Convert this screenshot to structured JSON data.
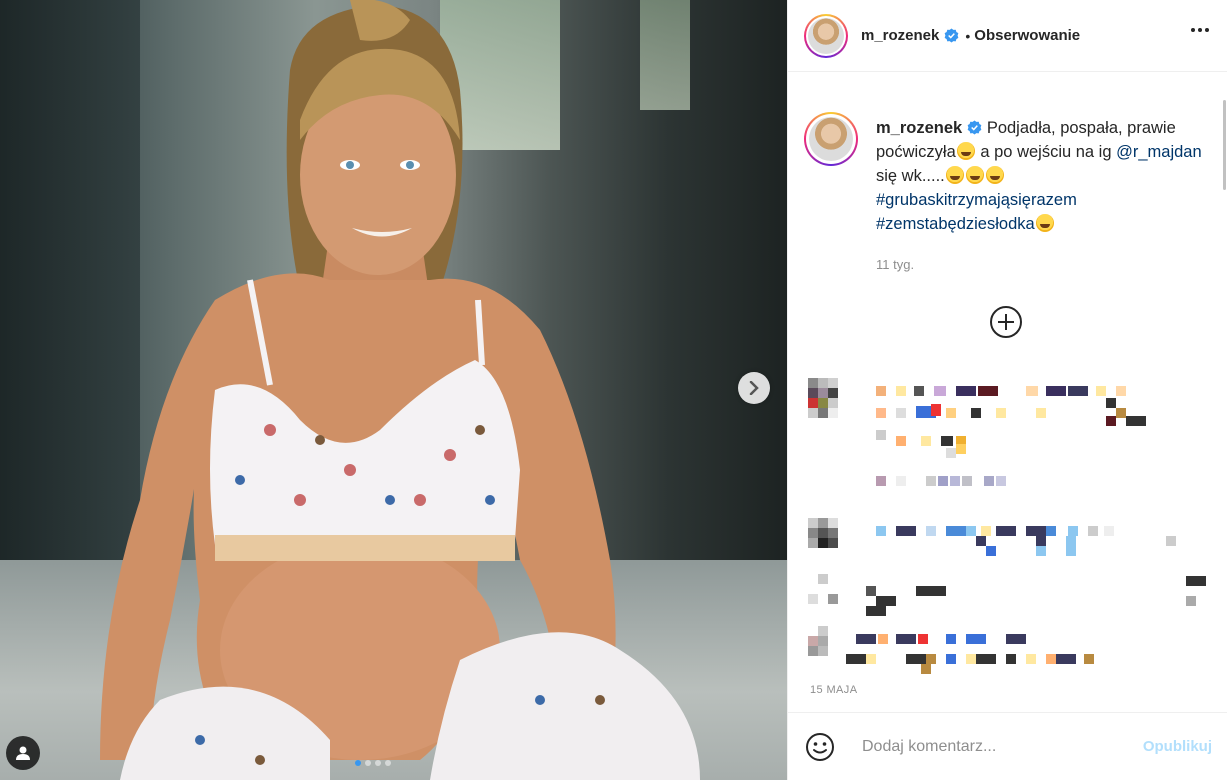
{
  "header": {
    "username": "m_rozenek",
    "separator": "•",
    "follow_label": "Obserwowanie"
  },
  "caption": {
    "username": "m_rozenek",
    "text_1": "Podjadła, pospała, prawie poćwiczyła",
    "text_2": " a po wejściu na ig ",
    "mention": "@r_majdan",
    "text_3": " się wk.....",
    "hashtag_1": "#grubaskitrzymająsięrazem",
    "hashtag_2": "#zemstabędziesłodka",
    "time_ago": "11 tyg."
  },
  "post": {
    "date": "15 MAJA"
  },
  "comment_box": {
    "placeholder": "Dodaj komentarz...",
    "post_label": "Opublikuj"
  },
  "colors": {
    "accent": "#3897f0",
    "link": "#003569",
    "post_button_disabled": "#b2dffc"
  },
  "icons": {
    "verified": "verified-badge-icon",
    "more": "more-options-icon",
    "next": "chevron-right-icon",
    "tag": "user-tag-icon",
    "load_more": "plus-circle-icon",
    "emoji": "smile-emoji-icon"
  }
}
